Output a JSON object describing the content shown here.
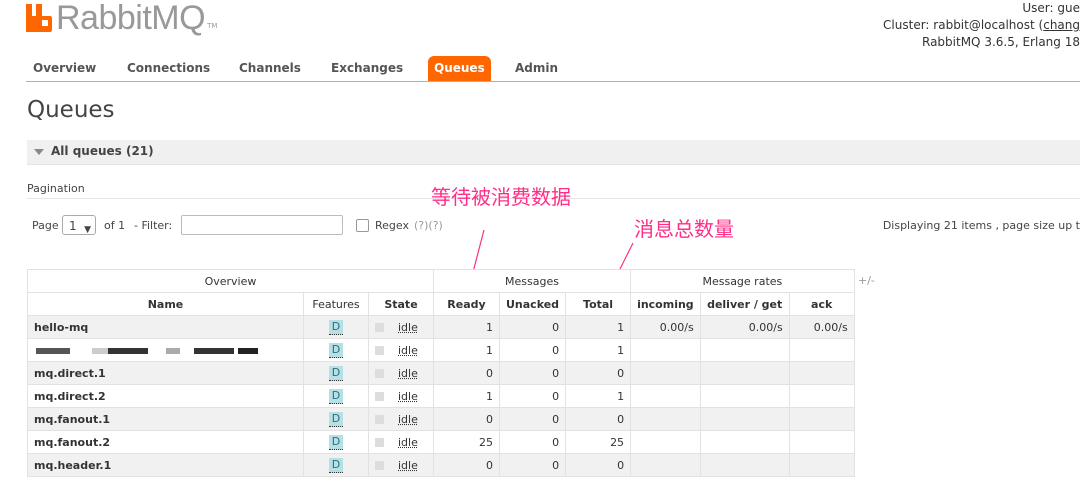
{
  "header": {
    "logo_text": "RabbitMQ",
    "logo_tm": "TM",
    "user_line": "User: gue",
    "cluster_prefix": "Cluster: rabbit@localhost (",
    "cluster_link": "chang",
    "version_line": "RabbitMQ 3.6.5, Erlang 18"
  },
  "tabs": [
    {
      "label": "Overview",
      "active": false
    },
    {
      "label": "Connections",
      "active": false
    },
    {
      "label": "Channels",
      "active": false
    },
    {
      "label": "Exchanges",
      "active": false
    },
    {
      "label": "Queues",
      "active": true
    },
    {
      "label": "Admin",
      "active": false
    }
  ],
  "page_title": "Queues",
  "section": {
    "label": "All queues (21)"
  },
  "pagination": {
    "label": "Pagination",
    "page_label": "Page",
    "page_value": "1",
    "of_label": "of 1",
    "filter_label": "- Filter:",
    "filter_value": "",
    "regex_label": "Regex",
    "help_links": "(?)(?)",
    "displaying": "Displaying 21 items , page size up t"
  },
  "annotations": {
    "ready_note": "等待被消费数据",
    "total_note": "消息总数量"
  },
  "table": {
    "group_headers": [
      "Overview",
      "Messages",
      "Message rates"
    ],
    "plus_minus": "+/-",
    "columns": [
      "Name",
      "Features",
      "State",
      "Ready",
      "Unacked",
      "Total",
      "incoming",
      "deliver / get",
      "ack"
    ],
    "rows": [
      {
        "name": "hello-mq",
        "feature": "D",
        "state": "idle",
        "ready": "1",
        "unacked": "0",
        "total": "1",
        "incoming": "0.00/s",
        "deliver": "0.00/s",
        "ack": "0.00/s"
      },
      {
        "name": "",
        "feature": "D",
        "state": "idle",
        "ready": "1",
        "unacked": "0",
        "total": "1",
        "incoming": "",
        "deliver": "",
        "ack": ""
      },
      {
        "name": "mq.direct.1",
        "feature": "D",
        "state": "idle",
        "ready": "0",
        "unacked": "0",
        "total": "0",
        "incoming": "",
        "deliver": "",
        "ack": ""
      },
      {
        "name": "mq.direct.2",
        "feature": "D",
        "state": "idle",
        "ready": "1",
        "unacked": "0",
        "total": "1",
        "incoming": "",
        "deliver": "",
        "ack": ""
      },
      {
        "name": "mq.fanout.1",
        "feature": "D",
        "state": "idle",
        "ready": "0",
        "unacked": "0",
        "total": "0",
        "incoming": "",
        "deliver": "",
        "ack": ""
      },
      {
        "name": "mq.fanout.2",
        "feature": "D",
        "state": "idle",
        "ready": "25",
        "unacked": "0",
        "total": "25",
        "incoming": "",
        "deliver": "",
        "ack": ""
      },
      {
        "name": "mq.header.1",
        "feature": "D",
        "state": "idle",
        "ready": "0",
        "unacked": "0",
        "total": "0",
        "incoming": "",
        "deliver": "",
        "ack": ""
      }
    ]
  },
  "colors": {
    "accent": "#ff6600",
    "annotation": "#ff2d87",
    "feature_badge": "#b6e0e6"
  }
}
